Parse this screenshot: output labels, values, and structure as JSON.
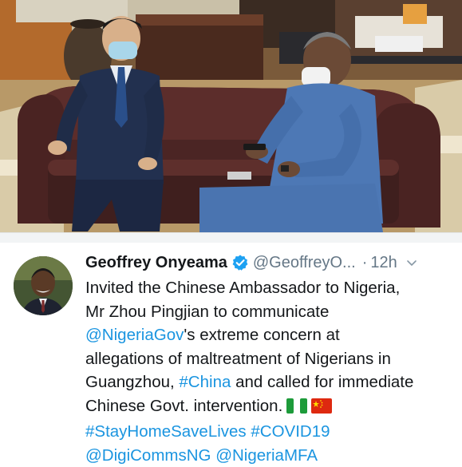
{
  "tweet": {
    "name": "Geoffrey Onyeama",
    "handle": "@GeoffreyO...",
    "separator": "·",
    "time": "12h",
    "verified_icon": "verified-badge-icon",
    "menu_icon": "chevron-down-icon",
    "text": {
      "line1": "Invited the Chinese Ambassador to Nigeria,",
      "line2": "Mr Zhou Pingjian to communicate",
      "mention1": "@NigeriaGov",
      "line3_rest": "'s extreme concern at",
      "line4": "allegations of maltreatment of Nigerians in",
      "line5_start": "Guangzhou, ",
      "hashtag1": "#China",
      "line5_rest": " and called for immediate",
      "line6": "Chinese Govt. intervention.",
      "hashtag2": "#StayHomeSaveLives",
      "hashtag3": "#COVID19",
      "mention2": "@DigiCommsNG",
      "mention3": "@NigeriaMFA"
    },
    "flags": [
      "nigeria-flag-icon",
      "china-flag-icon"
    ]
  },
  "colors": {
    "link": "#1b95e0",
    "text": "#14171a",
    "muted": "#657786",
    "verified": "#1da1f2"
  }
}
